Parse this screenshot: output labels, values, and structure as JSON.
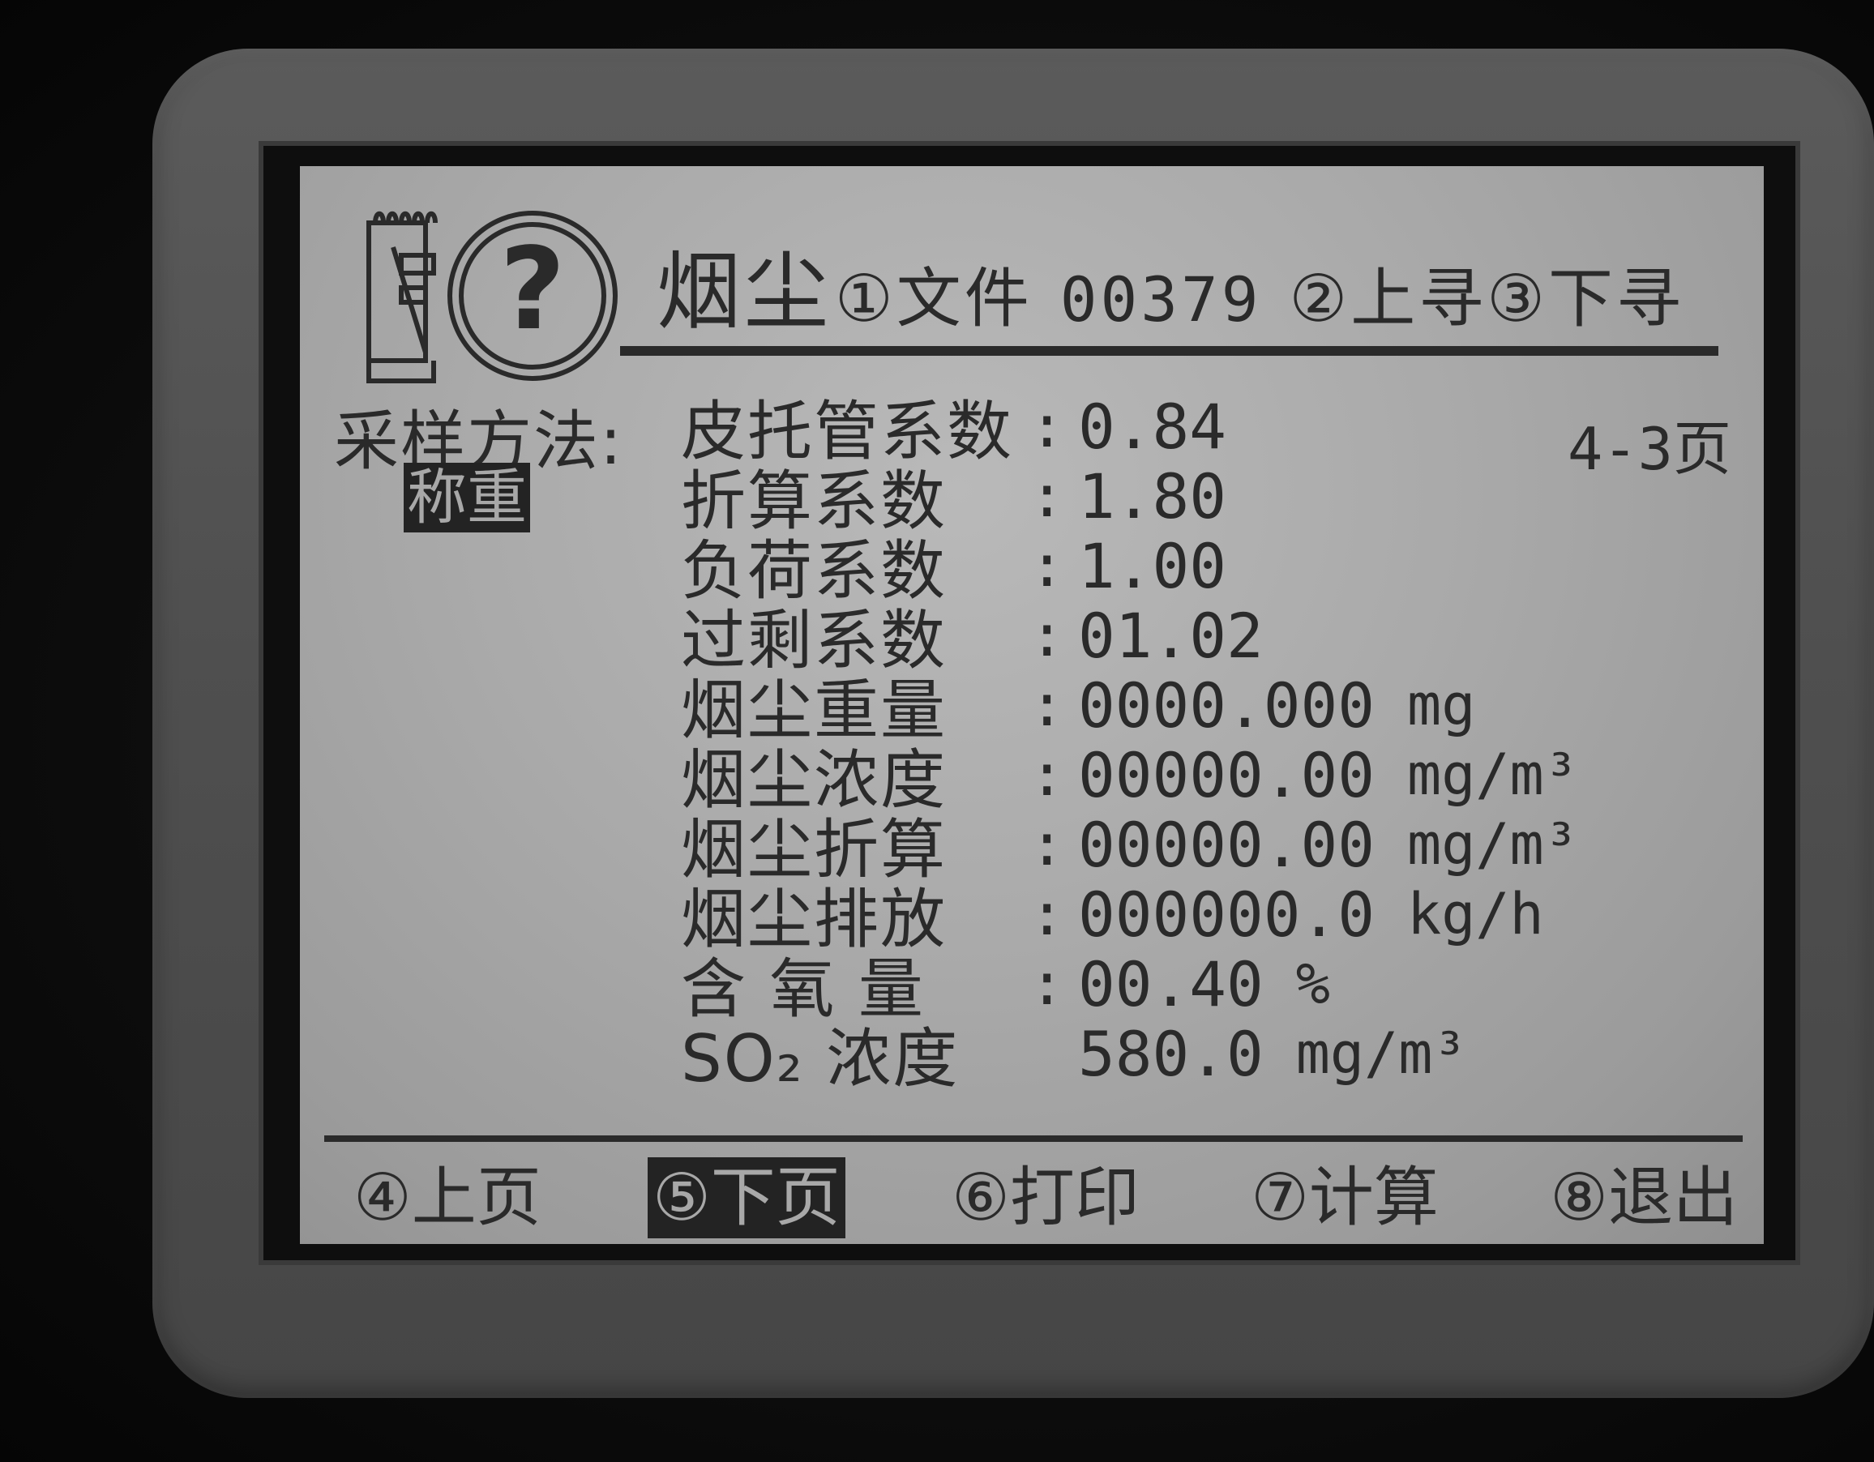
{
  "header": {
    "title": "烟尘",
    "file_label": "①文件",
    "file_number": "00379",
    "prev_search": "②上寻",
    "next_search": "③下寻"
  },
  "sampling": {
    "label": "采样方法:",
    "method": "称重"
  },
  "page_indicator": "4-3页",
  "rows": [
    {
      "label": "皮托管系数",
      "value": "0.84",
      "unit": ""
    },
    {
      "label": "折算系数",
      "value": "1.80",
      "unit": ""
    },
    {
      "label": "负荷系数",
      "value": "1.00",
      "unit": ""
    },
    {
      "label": "过剩系数",
      "value": "01.02",
      "unit": ""
    },
    {
      "label": "烟尘重量",
      "value": "0000.000",
      "unit": "mg"
    },
    {
      "label": "烟尘浓度",
      "value": "00000.00",
      "unit": "mg/m³"
    },
    {
      "label": "烟尘折算",
      "value": "00000.00",
      "unit": "mg/m³"
    },
    {
      "label": "烟尘排放",
      "value": "000000.0",
      "unit": "kg/h"
    },
    {
      "label": "含 氧 量",
      "value": "00.40",
      "unit": "%"
    },
    {
      "label": "SO₂ 浓度",
      "value": "580.0",
      "unit": "mg/m³"
    }
  ],
  "softkeys": [
    {
      "label": "④上页",
      "selected": false
    },
    {
      "label": "⑤下页",
      "selected": true
    },
    {
      "label": "⑥打印",
      "selected": false
    },
    {
      "label": "⑦计算",
      "selected": false
    },
    {
      "label": "⑧退出",
      "selected": false
    }
  ]
}
